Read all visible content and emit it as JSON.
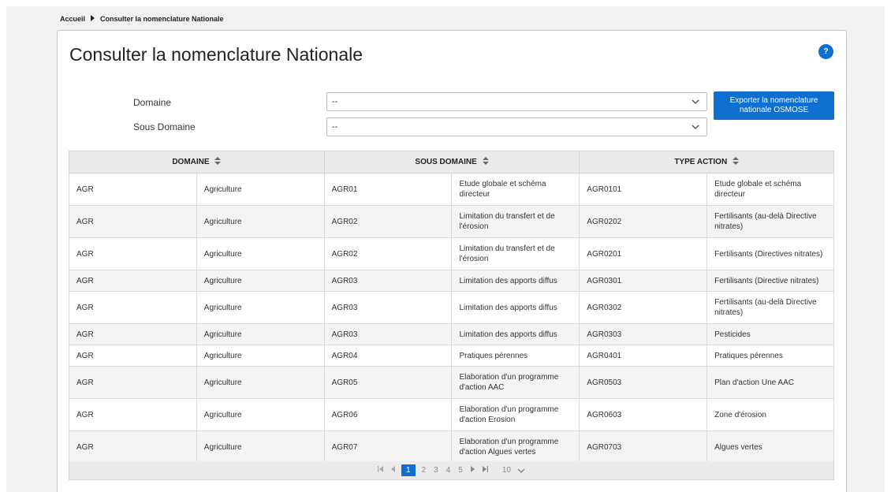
{
  "breadcrumb": {
    "home": "Accueil",
    "current": "Consulter la nomenclature Nationale"
  },
  "page": {
    "title": "Consulter la nomenclature Nationale",
    "help": "?"
  },
  "form": {
    "domaine_label": "Domaine",
    "domaine_value": "--",
    "sous_domaine_label": "Sous Domaine",
    "sous_domaine_value": "--",
    "export_label": "Exporter la nomenclature nationale OSMOSE"
  },
  "table": {
    "headers": [
      "DOMAINE",
      "SOUS DOMAINE",
      "TYPE ACTION"
    ],
    "rows": [
      [
        "AGR",
        "Agriculture",
        "AGR01",
        "Etude globale et schéma directeur",
        "AGR0101",
        "Etude globale et schéma directeur"
      ],
      [
        "AGR",
        "Agriculture",
        "AGR02",
        "Limitation du transfert et de l'érosion",
        "AGR0202",
        "Fertilisants (au-delà Directive nitrates)"
      ],
      [
        "AGR",
        "Agriculture",
        "AGR02",
        "Limitation du transfert et de l'érosion",
        "AGR0201",
        "Fertilisants (Directives nitrates)"
      ],
      [
        "AGR",
        "Agriculture",
        "AGR03",
        "Limitation des apports diffus",
        "AGR0301",
        "Fertilisants (Directive nitrates)"
      ],
      [
        "AGR",
        "Agriculture",
        "AGR03",
        "Limitation des apports diffus",
        "AGR0302",
        "Fertilisants (au-delà Directive nitrates)"
      ],
      [
        "AGR",
        "Agriculture",
        "AGR03",
        "Limitation des apports diffus",
        "AGR0303",
        "Pesticides"
      ],
      [
        "AGR",
        "Agriculture",
        "AGR04",
        "Pratiques pérennes",
        "AGR0401",
        "Pratiques pérennes"
      ],
      [
        "AGR",
        "Agriculture",
        "AGR05",
        "Elaboration d'un programme d'action AAC",
        "AGR0503",
        "Plan d'action Une AAC"
      ],
      [
        "AGR",
        "Agriculture",
        "AGR06",
        "Elaboration d'un programme d'action Erosion",
        "AGR0603",
        "Zone d'érosion"
      ],
      [
        "AGR",
        "Agriculture",
        "AGR07",
        "Elaboration d'un programme d'action Algues vertes",
        "AGR0703",
        "Algues vertes"
      ]
    ],
    "short_rows": [
      3,
      5,
      6
    ]
  },
  "pager": {
    "pages": [
      "1",
      "2",
      "3",
      "4",
      "5"
    ],
    "current": "1",
    "page_size": "10"
  },
  "colors": {
    "accent": "#0f6fd1"
  }
}
